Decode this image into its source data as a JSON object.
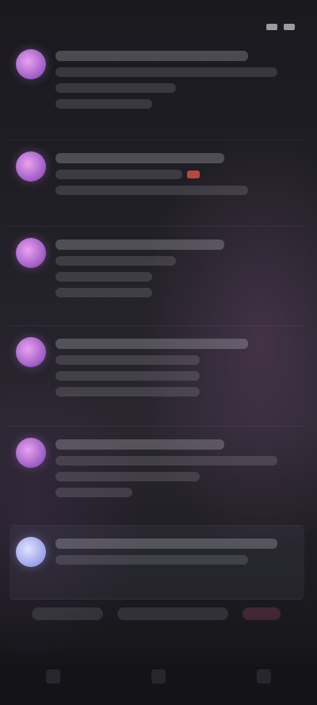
{
  "status_bar": {
    "time": "",
    "battery": ""
  },
  "feed": {
    "items": [
      {
        "avatar": "purple-avatar"
      },
      {
        "avatar": "purple-avatar"
      },
      {
        "avatar": "purple-avatar"
      },
      {
        "avatar": "purple-avatar"
      },
      {
        "avatar": "purple-avatar"
      },
      {
        "avatar": "lavender-avatar"
      }
    ]
  },
  "bottom_tabs": {
    "labels": [
      "",
      "",
      ""
    ]
  },
  "nav": {
    "icons": [
      "back-icon",
      "home-icon",
      "recents-icon"
    ]
  },
  "colors": {
    "avatar_purple": "#b56dd8",
    "avatar_lavender": "#b7bcf2",
    "accent_red": "#b8483f"
  }
}
